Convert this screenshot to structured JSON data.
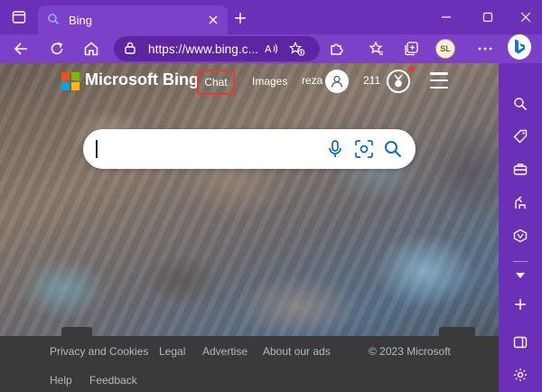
{
  "colors": {
    "chrome": "#6b2fb8",
    "toolbar": "#7d40c9",
    "accent": "#0f6cbd",
    "chat_highlight": "#e03a3a",
    "footer": "#3a3a3a"
  },
  "titlebar": {
    "tab_title": "Bing",
    "icons": [
      "tab-actions-icon",
      "bing-favicon-icon",
      "close-tab-icon",
      "new-tab-icon",
      "minimize-icon",
      "maximize-icon",
      "close-window-icon"
    ]
  },
  "toolbar": {
    "url": "https://www.bing.c...",
    "profile_initials": "SL",
    "icons": [
      "back-icon",
      "refresh-icon",
      "home-icon",
      "lock-icon",
      "read-aloud-icon",
      "add-favorite-icon",
      "extensions-icon",
      "favorites-icon",
      "collections-icon",
      "bing-copilot-icon"
    ]
  },
  "bing": {
    "brand": "Microsoft Bing",
    "nav": {
      "chat": "Chat",
      "images": "Images"
    },
    "user_name": "reza",
    "points": "211",
    "search": {
      "value": "",
      "placeholder": ""
    }
  },
  "footer": {
    "links": [
      "Privacy and Cookies",
      "Legal",
      "Advertise",
      "About our ads",
      "Help",
      "Feedback"
    ],
    "copyright": "© 2023 Microsoft"
  },
  "sidebar": {
    "icons": [
      "search-icon",
      "shopping-tag-icon",
      "tools-icon",
      "games-icon",
      "outlook-icon",
      "chevron-down-icon",
      "add-icon",
      "split-screen-icon",
      "settings-icon"
    ]
  }
}
